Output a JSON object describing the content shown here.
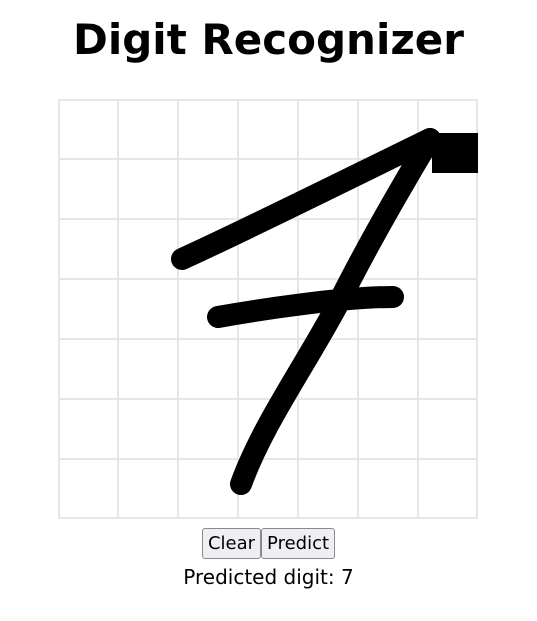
{
  "header": {
    "title": "Digit Recognizer"
  },
  "canvas": {
    "grid_color": "#e6e6e6",
    "stroke_color": "#000000",
    "background": "#ffffff"
  },
  "controls": {
    "clear_label": "Clear",
    "predict_label": "Predict"
  },
  "result": {
    "text": "Predicted digit: 7"
  }
}
